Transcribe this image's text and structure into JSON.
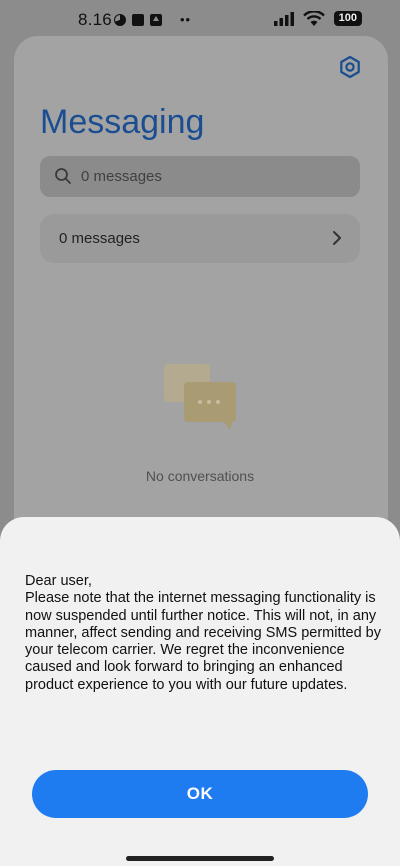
{
  "status_bar": {
    "time": "8.16",
    "battery": "100",
    "left_icons": [
      "pie-status-icon",
      "square-status-icon",
      "upload-status-icon",
      "more-dots-icon"
    ],
    "right_icons": [
      "signal-icon",
      "wifi-icon",
      "battery-icon"
    ]
  },
  "app": {
    "title": "Messaging",
    "search": {
      "placeholder": "0 messages"
    },
    "messages_row": {
      "label": "0 messages"
    },
    "empty_state": {
      "label": "No conversations"
    },
    "icons": [
      "settings-icon",
      "search-icon",
      "chevron-right-icon",
      "chat-bubbles-icon"
    ]
  },
  "dialog": {
    "greeting": "Dear user,",
    "message": "Please note that the internet messaging functionality is now suspended until further notice. This will not, in any manner, affect sending and receiving SMS permitted by your telecom carrier. We regret the inconvenience caused and look forward to bringing an enhanced product experience to you with our future updates.",
    "ok_label": "OK"
  },
  "colors": {
    "accent": "#1e7cf0",
    "title": "#1b4e90",
    "scrim": "#8c8c8c",
    "sheet": "#f1f1f1"
  }
}
